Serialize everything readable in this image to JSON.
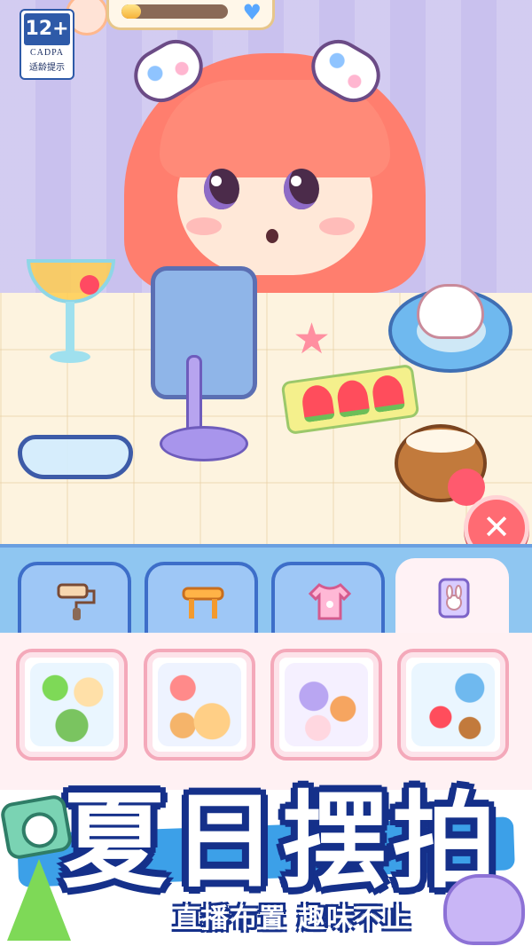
{
  "rating": {
    "age": "12+",
    "org": "CADPA",
    "label": "适龄提示"
  },
  "progress": {
    "fill_fraction": 0.18
  },
  "close_symbol": "✕",
  "tabs": [
    {
      "icon": "paint-roller-icon",
      "active": false
    },
    {
      "icon": "stool-icon",
      "active": false
    },
    {
      "icon": "shirt-icon",
      "active": false
    },
    {
      "icon": "bunny-phone-icon",
      "active": true
    }
  ],
  "cards": [
    {
      "icon": "decor-set-icon"
    },
    {
      "icon": "food-set-icon"
    },
    {
      "icon": "desk-items-set-icon"
    },
    {
      "icon": "summer-set-icon"
    }
  ],
  "banner": {
    "title": "夏日摆拍",
    "subtitle": "直播布置  趣味不止"
  },
  "colors": {
    "accent": "#ff6b73",
    "panel": "#8fc6f1",
    "title_outline": "#15308a"
  }
}
